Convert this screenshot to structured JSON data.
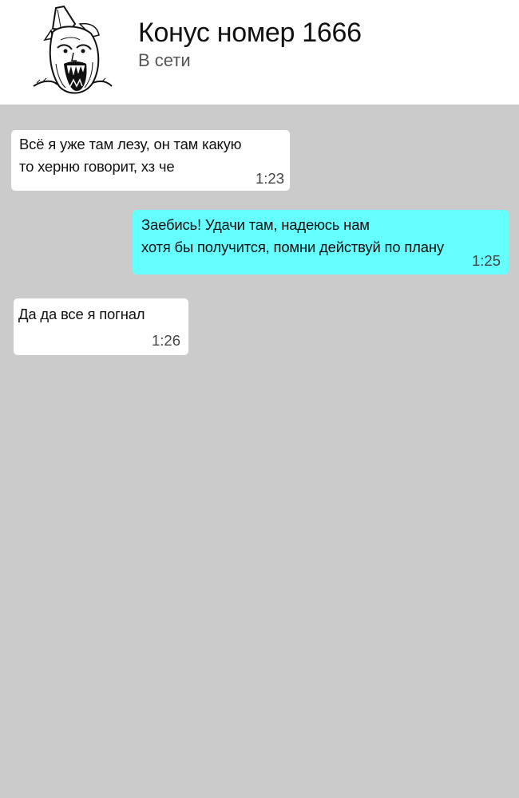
{
  "header": {
    "contact_name": "Конус номер 1666",
    "status": "В сети",
    "avatar_icon": "troll-face-avatar-icon"
  },
  "messages": [
    {
      "direction": "incoming",
      "lines": [
        "Всё я уже там лезу, он там какую",
        "то херню говорит, хз че"
      ],
      "time": "1:23"
    },
    {
      "direction": "outgoing",
      "lines": [
        "Заебись! Удачи там, надеюсь нам",
        "хотя бы получится, помни действуй по плану"
      ],
      "time": "1:25"
    },
    {
      "direction": "incoming",
      "lines": [
        "Да да все я погнал"
      ],
      "time": "1:26"
    }
  ],
  "colors": {
    "chat_background": "#cbcbcb",
    "header_background": "#ffffff",
    "incoming_bubble": "#ffffff",
    "outgoing_bubble": "#66ffff"
  }
}
